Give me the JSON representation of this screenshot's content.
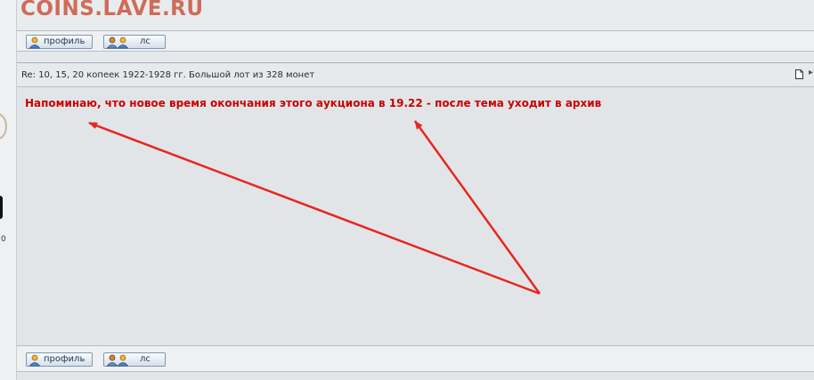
{
  "site": {
    "title": "COINS.LAVE.RU"
  },
  "buttons": {
    "profile_label": "профиль",
    "pm_label": "лс"
  },
  "post": {
    "subject": "Re: 10, 15, 20 копеек 1922-1928 гг. Большой лот из 328 монет",
    "message": "Напоминаю, что новое время окончания этого аукциона в 19.22 - после тема уходит в архив"
  },
  "left_column": {
    "count_fragment": "0"
  },
  "annotation": {
    "arrow_color": "#e8261f"
  },
  "colors": {
    "title": "#cf6b58",
    "message": "#cc0000",
    "body_bg": "#e1e5e8"
  },
  "icons": [
    "user-profile-icon",
    "users-pm-icon",
    "document-icon",
    "arrow-right-icon"
  ]
}
